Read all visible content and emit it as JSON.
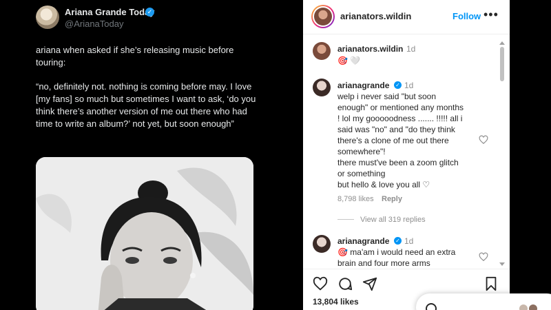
{
  "tweet": {
    "author_name": "Ariana Grande Today",
    "author_handle": "@ArianaToday",
    "paragraph_1": "ariana when asked if she’s releasing music before touring:",
    "paragraph_2": "“no, definitely not. nothing is coming before may. I love [my fans] so much but sometimes I want to ask, ‘do you think there’s another version of me out there who had time to write an album?’ not yet, but soon enough”",
    "photo_icon": "portrait-photo",
    "verified_icon": "verified-badge-icon"
  },
  "instagram": {
    "header": {
      "username": "arianators.wildin",
      "follow_label": "Follow",
      "more_label": "•••"
    },
    "comments": [
      {
        "username": "arianators.wildin",
        "time": "1d",
        "text": "🎯 🤍",
        "verified": false
      },
      {
        "username": "arianagrande",
        "time": "1d",
        "verified": true,
        "lines": [
          "welp i never said \"but soon",
          "enough\" or mentioned any months",
          "! lol my gooooodness ....... !!!!! all i",
          "said was \"no\" and \"do they think",
          "there's a clone of me out there",
          "somewhere\"!",
          "there must've been a zoom glitch",
          "or something",
          "but hello & love you all ♡"
        ],
        "likes": "8,798 likes",
        "reply_label": "Reply",
        "view_replies": "View all 319 replies"
      },
      {
        "username": "arianagrande",
        "time": "1d",
        "verified": true,
        "lines": [
          "🎯 ma'am i would need an extra",
          "brain and four more arms"
        ]
      }
    ],
    "likes_total": "13,804 likes",
    "icons": [
      "heart-icon",
      "comment-icon",
      "share-icon",
      "bookmark-icon"
    ],
    "accent_color": "#0095f6"
  }
}
